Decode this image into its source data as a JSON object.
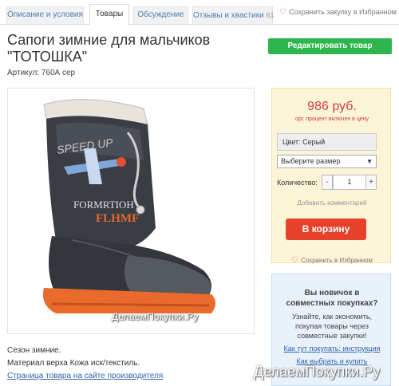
{
  "tabs": [
    {
      "label": "Описание и условия"
    },
    {
      "label": "Товары"
    },
    {
      "label": "Обсуждение"
    },
    {
      "label": "Отзывы и хвастики",
      "count": "61"
    }
  ],
  "favorite_top": "Сохранить закупку в Избранном",
  "product": {
    "title_line1": "Сапоги зимние для мальчиков",
    "title_line2": "\"ТОТОШКА\"",
    "article": "Артикул: 760А сер",
    "boot_text1": "FORMRTIOH",
    "boot_text2": "FLHMF",
    "boot_text3": "SPEED UP"
  },
  "edit_button": "Редактировать товар",
  "order": {
    "price": "986 руб.",
    "price_note": "орг. процент включен в цену",
    "color": "Цвет: Серый",
    "size_placeholder": "Выберите размер",
    "qty_label": "Количество:",
    "qty_minus": "-",
    "qty_value": "1",
    "qty_plus": "+",
    "add_comment": "Добавить комментарий",
    "cart_button": "В корзину",
    "favorite": "Сохранить в Избранном"
  },
  "watermark_small": "ДелаемПокупки.Ру",
  "watermark_big": "ДелаемПокупки.Ру",
  "description": {
    "season": "Сезон зимние.",
    "material": "Материал верха Кожа иск/текстиль.",
    "link": "Страница товара на сайте производителя"
  },
  "newbie": {
    "title_line1": "Вы новичок в",
    "title_line2": "совместных покупках?",
    "text_line1": "Узнайте, как экономить,",
    "text_line2": "покупая товары через",
    "text_line3": "совместные закупки!",
    "link1": "Как тут покупать: инструкция",
    "link2": "Как выбрать и купить"
  },
  "colors": {
    "accent_green": "#2db64d",
    "cart_red": "#e8412b",
    "price_red": "#d04040",
    "link_blue": "#3366aa"
  }
}
